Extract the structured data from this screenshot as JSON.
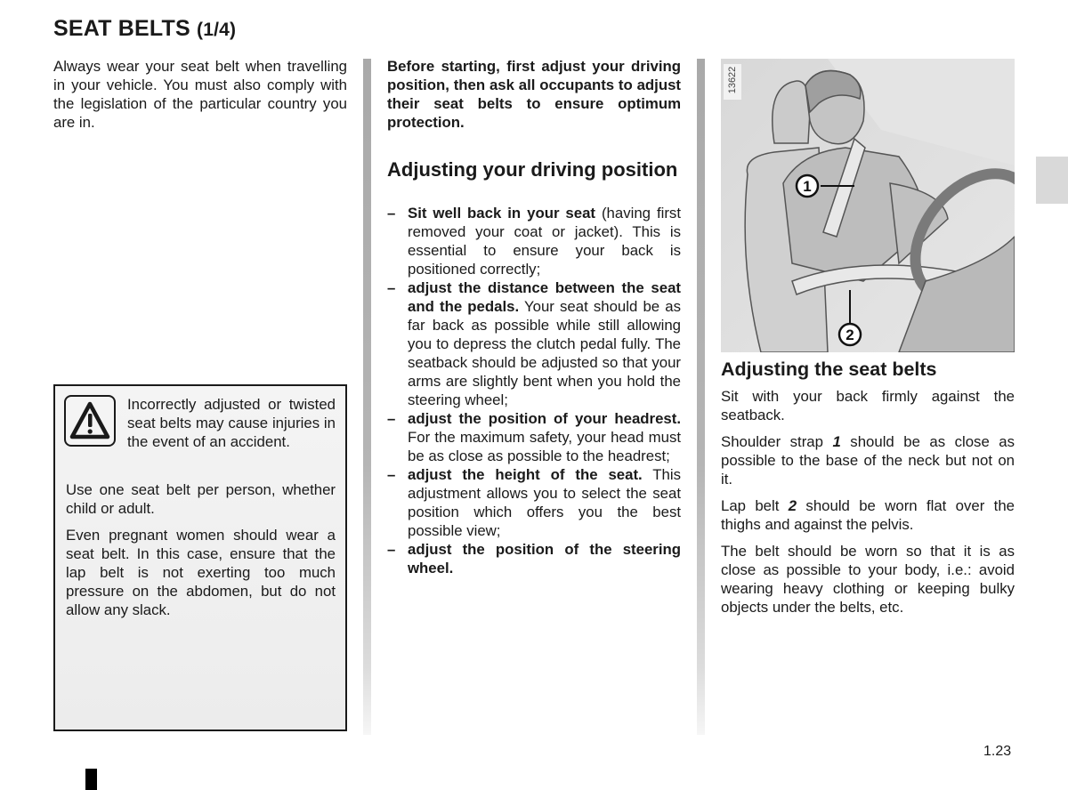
{
  "title": {
    "main": "SEAT BELTS",
    "part": "(1/4)"
  },
  "column1": {
    "intro": "Always wear your seat belt when travelling in your vehicle. You must also comply with the legislation of the particular country you are in.",
    "warning": {
      "icon": "warning-triangle-icon",
      "p1": "Incorrectly adjusted or twisted seat belts may cause injuries in the event of an accident.",
      "p2": "Use one seat belt per person, whether child or adult.",
      "p3": "Even pregnant women should wear a seat belt. In this case, ensure that the lap belt is not exerting too much pressure on the abdomen, but do not allow any slack."
    }
  },
  "column2": {
    "intro": "Before starting, first adjust your driving position, then ask all occupants to adjust their seat belts to ensure optimum protection.",
    "heading": "Adjusting your driving position",
    "items": [
      {
        "bold": "Sit well back in your seat",
        "text": " (having first removed your coat or jacket). This is essential to ensure your back is positioned correctly;"
      },
      {
        "bold": "adjust the distance between the seat and the pedals.",
        "text": " Your seat should be as far back as possible while still allowing you to depress the clutch pedal fully. The seatback should be adjusted so that your arms are slightly bent when you hold the steering wheel;"
      },
      {
        "bold": "adjust the position of your headrest.",
        "text": " For the maximum safety, your head must be as close as possible to the headrest;"
      },
      {
        "bold": "adjust the height of the seat.",
        "text": " This adjustment allows you to select the seat position which offers you the best possible view;"
      },
      {
        "bold": "adjust the position of the steering wheel.",
        "text": ""
      }
    ],
    "dash": "–"
  },
  "column3": {
    "figure": {
      "number": "13622",
      "callout1": "1",
      "callout2": "2",
      "alt": "Driver seated with shoulder strap 1 and lap belt 2"
    },
    "heading": "Adjusting the seat belts",
    "p1": "Sit with your back firmly against the seatback.",
    "p2_pre": "Shoulder strap ",
    "p2_num": "1",
    "p2_post": " should be as close as possible to the base of the neck but not on it.",
    "p3_pre": "Lap belt ",
    "p3_num": "2",
    "p3_post": " should be worn flat over the thighs and against the pelvis.",
    "p4": "The belt should be worn so that it is as close as possible to your body, i.e.: avoid wearing heavy clothing or keeping bulky objects under the belts, etc."
  },
  "footer": {
    "page_number": "1.23"
  }
}
